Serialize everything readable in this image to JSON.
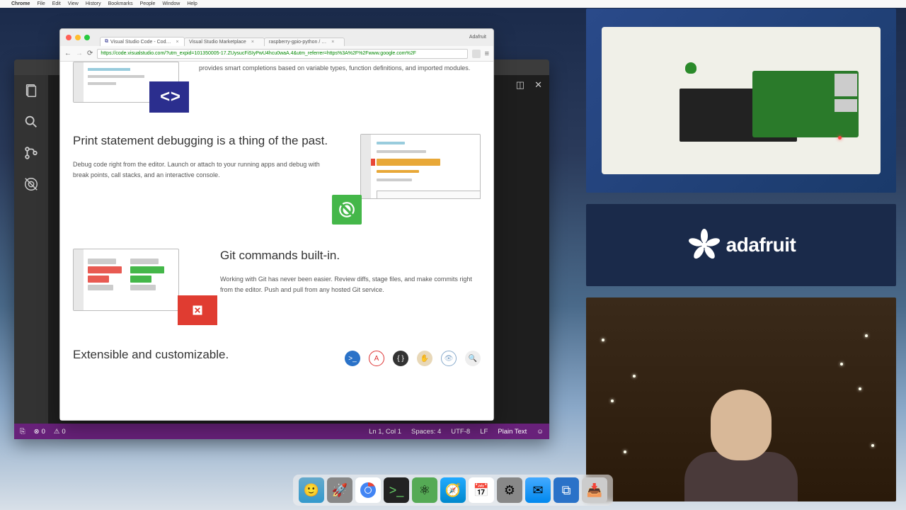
{
  "mac_menu": {
    "items": [
      "Chrome",
      "File",
      "Edit",
      "View",
      "History",
      "Bookmarks",
      "People",
      "Window",
      "Help"
    ]
  },
  "chrome": {
    "user": "Adafruit",
    "tabs": [
      {
        "label": "Visual Studio Code - Cod…"
      },
      {
        "label": "Visual Studio Marketplace"
      },
      {
        "label": "raspberry-gpio-python / …"
      }
    ],
    "url": "https://code.visualstudio.com/?utm_expid=101350005-17.ZUysucFiSIyPwU4hcu0waA.4&utm_referrer=https%3A%2F%2Fwww.google.com%2F"
  },
  "page": {
    "intel_body": "provides smart completions based on variable types, function definitions, and imported modules.",
    "debug": {
      "title": "Print statement debugging is a thing of the past.",
      "body": "Debug code right from the editor. Launch or attach to your running apps and debug with break points, call stacks, and an interactive console."
    },
    "git": {
      "title": "Git commands built-in.",
      "body": "Working with Git has never been easier. Review diffs, stage files, and make commits right from the editor. Push and pull from any hosted Git service."
    },
    "ext": {
      "title": "Extensible and customizable."
    }
  },
  "vscode_status": {
    "errors": "0",
    "warnings": "0",
    "position": "Ln 1, Col 1",
    "spaces": "Spaces: 4",
    "encoding": "UTF-8",
    "eol": "LF",
    "language": "Plain Text"
  },
  "brand": {
    "name": "adafruit"
  },
  "dock_items": [
    "finder",
    "launchpad",
    "chrome",
    "terminal",
    "atom",
    "safari",
    "calendar",
    "settings",
    "mail",
    "vscode",
    "downloads"
  ]
}
